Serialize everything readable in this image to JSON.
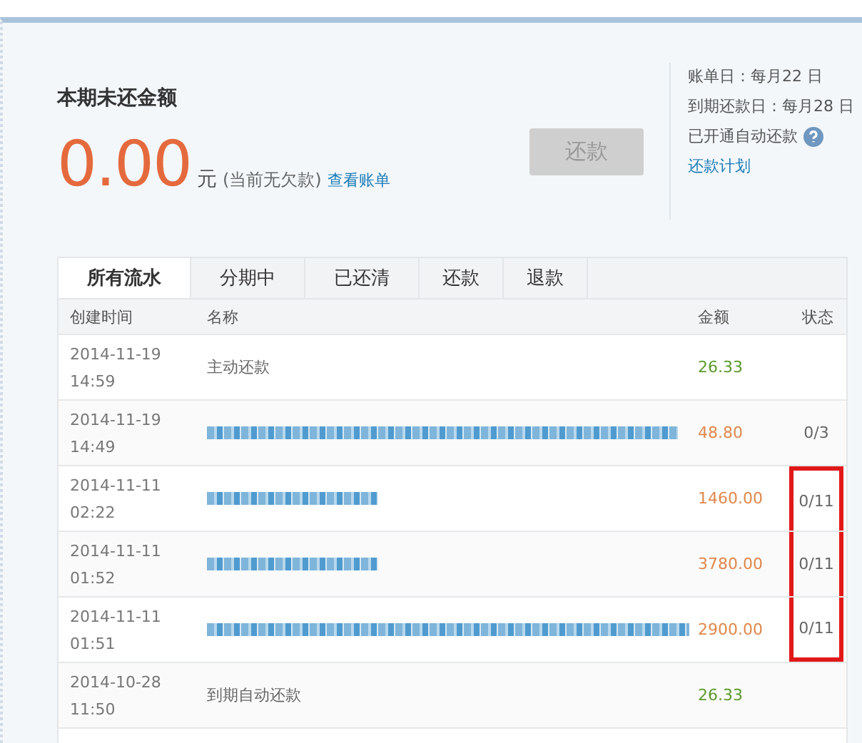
{
  "summary": {
    "title": "本期未还金额",
    "amount": "0.00",
    "unit": "元",
    "note": "(当前无欠款)",
    "link": "查看账单",
    "pay_button": {
      "label": "还款",
      "disabled": true
    }
  },
  "info": {
    "lines": [
      "账单日：每月22 日",
      "到期还款日：每月28 日"
    ],
    "auto_repay": "已开通自动还款",
    "plan_link": "还款计划"
  },
  "tabs": [
    {
      "label": "所有流水",
      "selected": true
    },
    {
      "label": "分期中",
      "selected": false
    },
    {
      "label": "已还清",
      "selected": false
    },
    {
      "label": "还款",
      "selected": false
    },
    {
      "label": "退款",
      "selected": false
    }
  ],
  "table": {
    "columns": [
      "创建时间",
      "名称",
      "金额",
      "状态"
    ],
    "rows": [
      {
        "date": "2014-11-19",
        "time": "14:59",
        "name": "主动还款",
        "redacted": false,
        "amount": "26.33",
        "kind": "repayment",
        "highlighted": false
      },
      {
        "date": "2014-11-19",
        "time": "14:49",
        "redacted": true,
        "amount": "48.80",
        "status": "0/3",
        "kind": "purchase",
        "highlighted": false
      },
      {
        "date": "2014-11-11",
        "time": "02:22",
        "redacted": true,
        "amount": "1460.00",
        "status": "0/11",
        "kind": "purchase",
        "highlighted": true
      },
      {
        "date": "2014-11-11",
        "time": "01:52",
        "redacted": true,
        "amount": "3780.00",
        "status": "0/11",
        "kind": "purchase",
        "highlighted": true
      },
      {
        "date": "2014-11-11",
        "time": "01:51",
        "redacted": true,
        "amount": "2900.00",
        "status": "0/11",
        "kind": "purchase",
        "highlighted": true
      },
      {
        "date": "2014-10-28",
        "time": "11:50",
        "name": "到期自动还款",
        "redacted": false,
        "amount": "26.33",
        "kind": "repayment",
        "highlighted": false
      }
    ]
  }
}
